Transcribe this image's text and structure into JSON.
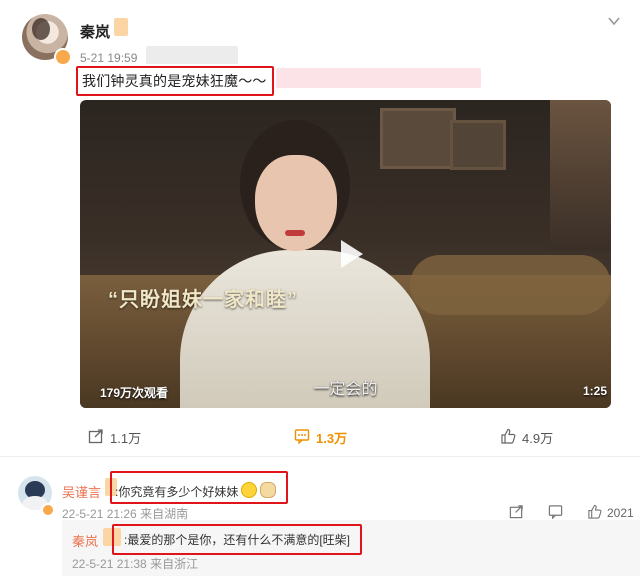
{
  "post": {
    "author": "秦岚",
    "time": "5-21 19:59",
    "text": "我们钟灵真的是宠妹狂魔～～",
    "menu_icon": "chevron-down-icon"
  },
  "video": {
    "caption": "“只盼姐妹一家和睦”",
    "subtitle": "一定会的",
    "views": "179万次观看",
    "duration": "1:25",
    "play_icon": "play-icon"
  },
  "actions": {
    "share": "1.1万",
    "comment": "1.3万",
    "like": "4.9万"
  },
  "comments": [
    {
      "name": "吴谨言",
      "text": ":你究竟有多少个好妹妹",
      "time": "22-5-21 21:26",
      "location": "来自湖南",
      "like_count": "2021"
    }
  ],
  "reply": {
    "name": "秦岚",
    "text": ":最爱的那个是你，还有什么不满意的[旺柴]",
    "time": "22-5-21 21:38",
    "location": "来自浙江"
  },
  "colors": {
    "highlight_box": "#e0141b",
    "username": "#eb7350",
    "comment_accent": "#f29100"
  }
}
